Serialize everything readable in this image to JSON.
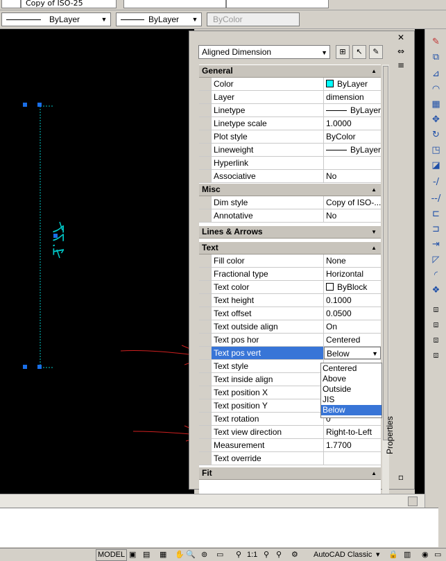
{
  "toolbar_top": {
    "dimstyle_value": "Copy of ISO-25"
  },
  "toolbar_layers": {
    "color_value": "ByLayer",
    "linetype_value": "ByLayer",
    "plotstyle_value": "ByColor"
  },
  "drawing": {
    "dimension_text": "1.77"
  },
  "palette": {
    "object_type": "Aligned Dimension",
    "vertical_title": "Properties",
    "sections": {
      "general": "General",
      "misc": "Misc",
      "lines": "Lines & Arrows",
      "text": "Text",
      "fit": "Fit"
    },
    "general": [
      {
        "name": "Color",
        "value": "ByLayer",
        "swatch": "#00ffff"
      },
      {
        "name": "Layer",
        "value": "dimension"
      },
      {
        "name": "Linetype",
        "value": "ByLayer"
      },
      {
        "name": "Linetype scale",
        "value": "1.0000"
      },
      {
        "name": "Plot style",
        "value": "ByColor"
      },
      {
        "name": "Lineweight",
        "value": "ByLayer"
      },
      {
        "name": "Hyperlink",
        "value": ""
      },
      {
        "name": "Associative",
        "value": "No"
      }
    ],
    "misc": [
      {
        "name": "Dim style",
        "value": "Copy of ISO-..."
      },
      {
        "name": "Annotative",
        "value": "No"
      }
    ],
    "text": [
      {
        "name": "Fill color",
        "value": "None"
      },
      {
        "name": "Fractional type",
        "value": "Horizontal"
      },
      {
        "name": "Text color",
        "value": "ByBlock",
        "swatch": "#ffffff"
      },
      {
        "name": "Text height",
        "value": "0.1000"
      },
      {
        "name": "Text offset",
        "value": "0.0500"
      },
      {
        "name": "Text outside align",
        "value": "On"
      },
      {
        "name": "Text pos hor",
        "value": "Centered"
      },
      {
        "name": "Text pos vert",
        "value": "Below"
      },
      {
        "name": "Text style",
        "value": ""
      },
      {
        "name": "Text inside align",
        "value": ""
      },
      {
        "name": "Text position X",
        "value": ""
      },
      {
        "name": "Text position Y",
        "value": ""
      },
      {
        "name": "Text rotation",
        "value": "0"
      },
      {
        "name": "Text view direction",
        "value": "Right-to-Left"
      },
      {
        "name": "Measurement",
        "value": "1.7700"
      },
      {
        "name": "Text override",
        "value": ""
      }
    ],
    "dropdown_options": [
      "Centered",
      "Above",
      "Outside",
      "JIS",
      "Below"
    ],
    "dropdown_selected": "Below"
  },
  "status": {
    "model": "MODEL",
    "scale": "1:1",
    "workspace": "AutoCAD Classic"
  },
  "colors": {
    "accent": "#3875d7",
    "canvas": "#000000",
    "grip": "#1a6fe8",
    "dimension": "#00c8c8",
    "annotation_arrow": "#d02020"
  }
}
